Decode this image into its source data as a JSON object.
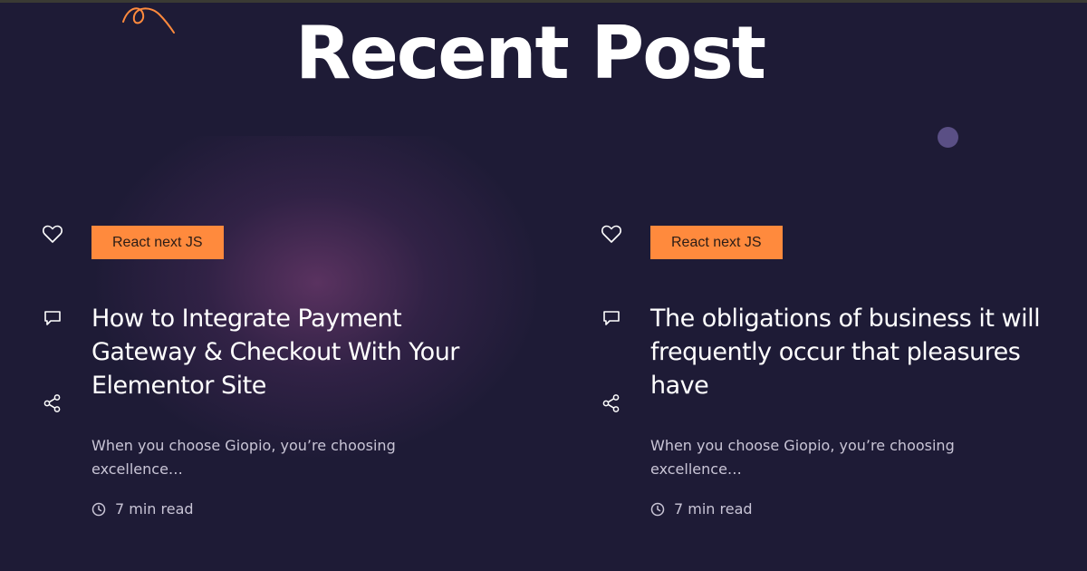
{
  "section": {
    "title": "Recent Post"
  },
  "posts": [
    {
      "tag": "React next JS",
      "title": "How to Integrate Payment Gateway & Checkout With Your Elementor Site",
      "excerpt": "When you choose Giopio, you’re choosing excellence…",
      "read_time": "7 min read"
    },
    {
      "tag": "React next JS",
      "title": "The obligations of business it will frequently occur that pleasures have",
      "excerpt": "When you choose Giopio, you’re choosing excellence…",
      "read_time": "7 min read"
    }
  ],
  "icons": {
    "like": "heart-icon",
    "comment": "comment-icon",
    "share": "share-icon",
    "clock": "clock-icon"
  },
  "colors": {
    "background": "#1e1b36",
    "accent": "#ff8a3d",
    "text": "#ffffff",
    "muted_text": "#c9c5d6"
  }
}
